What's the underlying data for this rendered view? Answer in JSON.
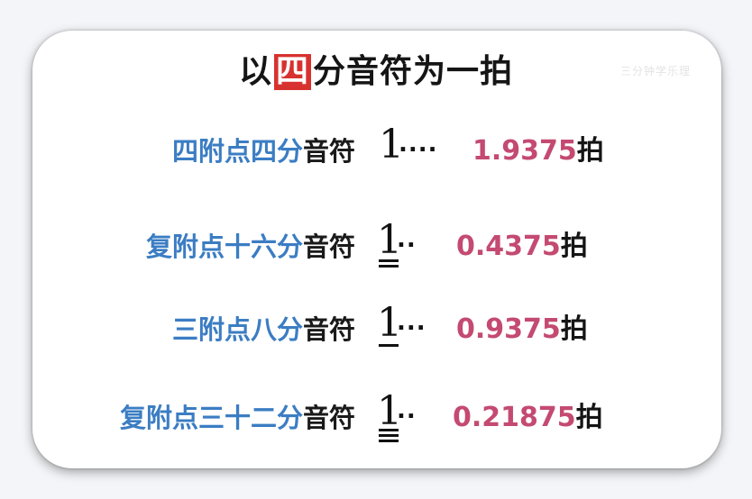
{
  "title": {
    "before": "以",
    "highlight": "四",
    "after": "分音符为一拍"
  },
  "watermark": "三分钟学乐理",
  "rows": [
    {
      "label_blue": "四附点四分",
      "label_dark": "音符",
      "note_one": "1",
      "note_dots": "....",
      "value": "1.9375",
      "unit": "拍"
    },
    {
      "label_blue": "复附点十六分",
      "label_dark": "音符",
      "note_one": "1",
      "note_dots": "..",
      "value": "0.4375",
      "unit": "拍"
    },
    {
      "label_blue": "三附点八分",
      "label_dark": "音符",
      "note_one": "1",
      "note_dots": "...",
      "value": "0.9375",
      "unit": "拍"
    },
    {
      "label_blue": "复附点三十二分",
      "label_dark": "音符",
      "note_one": "1",
      "note_dots": "..",
      "value": "0.21875",
      "unit": "拍"
    }
  ]
}
